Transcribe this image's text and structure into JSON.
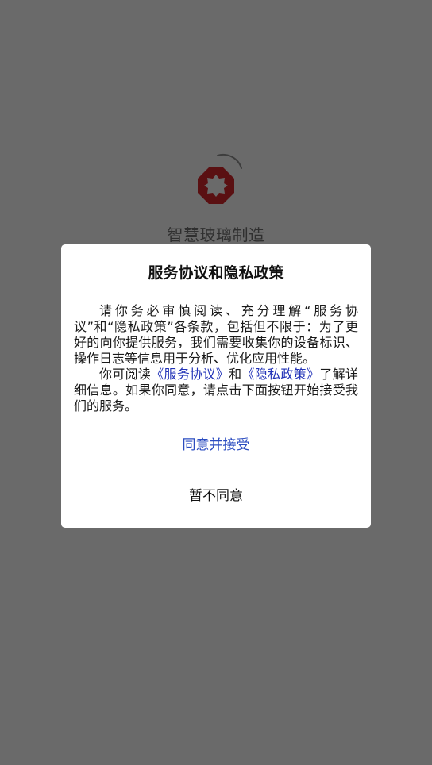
{
  "splash": {
    "app_name": "智慧玻璃制造",
    "logo_icon": "octagon-logo-icon",
    "spinner_icon": "loading-spinner-icon",
    "brand_color": "#8b0f14"
  },
  "dialog": {
    "title": "服务协议和隐私政策",
    "para1": "请你务必审慎阅读、充分理解“服务协议”和“隐私政策”各条款，包括但不限于：为了更好的向你提供服务，我们需要收集你的设备标识、操作日志等信息用于分析、优化应用性能。",
    "para2_prefix": "你可阅读",
    "link_service": "《服务协议》",
    "para2_and": "和",
    "link_privacy": "《隐私政策》",
    "para2_suffix": "了解详细信息。如果你同意，请点击下面按钮开始接受我们的服务。",
    "agree_label": "同意并接受",
    "decline_label": "暂不同意",
    "link_color": "#2233b8"
  }
}
